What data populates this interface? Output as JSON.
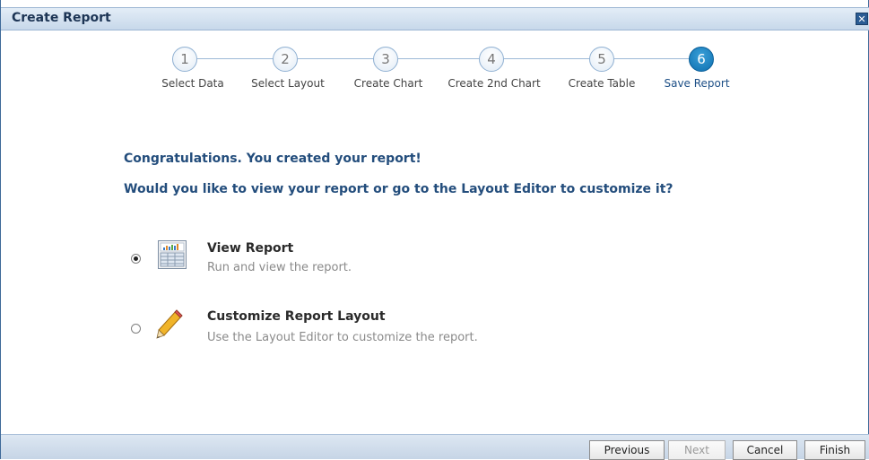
{
  "dialog": {
    "title": "Create Report",
    "close_icon": "close-icon"
  },
  "train": {
    "steps": [
      {
        "number": "1",
        "label": "Select Data"
      },
      {
        "number": "2",
        "label": "Select Layout"
      },
      {
        "number": "3",
        "label": "Create Chart"
      },
      {
        "number": "4",
        "label": "Create 2nd Chart"
      },
      {
        "number": "5",
        "label": "Create Table"
      },
      {
        "number": "6",
        "label": "Save Report"
      }
    ],
    "active_step": 6,
    "active_color": "#0d6fb0"
  },
  "content": {
    "congrats": "Congratulations. You created your report!",
    "question": "Would you like to view your report or go to the Layout Editor to customize it?",
    "options": [
      {
        "title": "View Report",
        "description": "Run and view the report.",
        "icon": "report-icon",
        "selected": true
      },
      {
        "title": "Customize Report Layout",
        "description": "Use the Layout Editor to customize the report.",
        "icon": "pencil-icon",
        "selected": false
      }
    ]
  },
  "footer": {
    "previous_label": "Previous",
    "next_label": "Next",
    "cancel_label": "Cancel",
    "finish_label": "Finish"
  }
}
